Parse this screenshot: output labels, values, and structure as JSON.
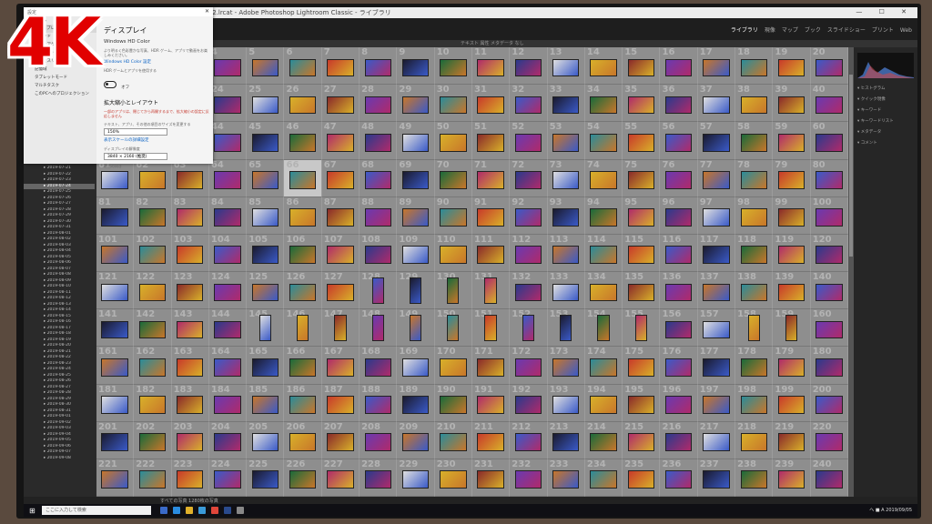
{
  "badge": {
    "text": "4K"
  },
  "window": {
    "title_text": "Lightroom Catalog-2.lrcat - Adobe Photoshop Lightroom Classic - ライブラリ",
    "controls": "—  ☐  ✕"
  },
  "modules": [
    "ライブラリ",
    "現像",
    "マップ",
    "ブック",
    "スライドショー",
    "プリント",
    "Web"
  ],
  "filter_bar": {
    "text": "テキスト  属性  メタデータ  なし"
  },
  "folders": {
    "items": [
      "2019-07-01",
      "2019-07-02",
      "2019-07-03",
      "2019-07-04",
      "2019-07-05",
      "2019-07-06",
      "2019-07-07",
      "2019-07-08",
      "2019-07-09",
      "2019-07-10",
      "2019-07-11",
      "2019-07-12",
      "2019-07-13",
      "2019-07-14",
      "2019-07-15",
      "2019-07-16",
      "2019-07-17",
      "2019-07-18",
      "2019-07-19",
      "2019-07-20",
      "2019-07-21",
      "2019-07-22",
      "2019-07-23",
      "2019-07-24",
      "2019-07-25",
      "2019-07-26",
      "2019-07-27",
      "2019-07-28",
      "2019-07-29",
      "2019-07-30",
      "2019-07-31",
      "2019-08-01",
      "2019-08-02",
      "2019-08-03",
      "2019-08-04",
      "2019-08-05",
      "2019-08-06",
      "2019-08-07",
      "2019-08-08",
      "2019-08-09",
      "2019-08-10",
      "2019-08-11",
      "2019-08-12",
      "2019-08-13",
      "2019-08-14",
      "2019-08-15",
      "2019-08-16",
      "2019-08-17",
      "2019-08-18",
      "2019-08-19",
      "2019-08-20",
      "2019-08-21",
      "2019-08-22",
      "2019-08-23",
      "2019-08-24",
      "2019-08-25",
      "2019-08-26",
      "2019-08-27",
      "2019-08-28",
      "2019-08-29",
      "2019-08-30",
      "2019-08-31",
      "2019-09-01",
      "2019-09-02",
      "2019-09-03",
      "2019-09-04",
      "2019-09-05",
      "2019-09-06",
      "2019-09-07",
      "2019-09-08"
    ],
    "selected_index": 23
  },
  "grid": {
    "start_number": 1,
    "columns": 20,
    "rows": 12,
    "selected_number": 66,
    "portrait_numbers": [
      128,
      129,
      130,
      131,
      145,
      146,
      147,
      148,
      149,
      150,
      151,
      152,
      153,
      154,
      155,
      158,
      159
    ],
    "thumb_colors": [
      "#2a3a8c",
      "#c83a2a",
      "#d8b02a",
      "#1a1a2e",
      "#6a3ab0",
      "#b02a6a",
      "#2a8c9a",
      "#e0e0e0",
      "#3a5ac8",
      "#8a2a2a",
      "#1a6a3a",
      "#c8762a"
    ]
  },
  "right_panel": {
    "rows": [
      "ヒストグラム",
      "クイック現像",
      "キーワード",
      "キーワードリスト",
      "メタデータ",
      "コメント"
    ]
  },
  "filmstrip": {
    "text": "すべての写真  1280枚の写真"
  },
  "taskbar": {
    "search_placeholder": "ここに入力して検索",
    "tray_text": "へ  ■  A  2019/09/05"
  },
  "settings": {
    "window_title": "設定",
    "nav": [
      "ホーム",
      "ディスプレイ",
      "サウンド",
      "通知とアクション",
      "集中モード",
      "電源とスリープ",
      "記憶域",
      "タブレットモード",
      "マルチタスク",
      "このPCへのプロジェクション"
    ],
    "heading": "ディスプレイ",
    "hdr_title": "Windows HD Color",
    "hdr_desc": "より明るく色彩豊かな写真、HDR ゲーム、アプリで動画をお楽しみください。",
    "hdr_link": "Windows HD Color 設定",
    "hdr_toggle_label": "HDR ゲームとアプリを使用する",
    "hdr_toggle_state": "オフ",
    "scale_heading": "拡大縮小とレイアウト",
    "scale_warning": "一部のアプリは、閉じてから再開するまで、拡大縮小の設定に反応しません",
    "scale_label": "テキスト、アプリ、その他の項目のサイズを変更する",
    "scale_value": "150%",
    "scale_link": "表示スケールの詳細設定",
    "res_label": "ディスプレイの解像度",
    "res_value": "3840 × 2160 (推奨)",
    "orient_label": "画面の向き"
  }
}
